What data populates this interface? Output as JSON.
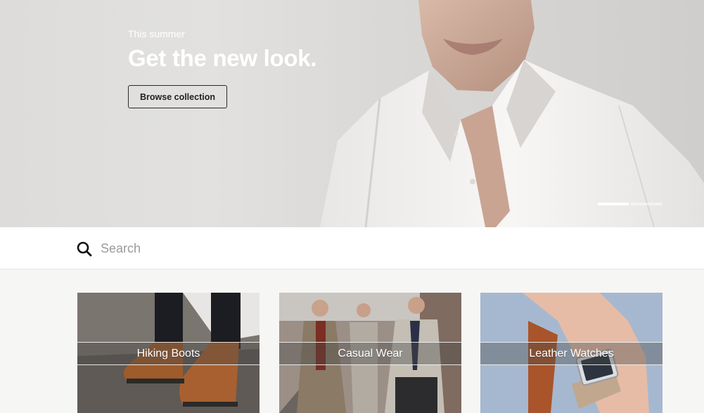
{
  "hero": {
    "kicker": "This summer",
    "title": "Get the new look.",
    "button_label": "Browse collection",
    "slides": [
      {
        "active": true
      },
      {
        "active": false
      }
    ]
  },
  "search": {
    "placeholder": "Search",
    "value": ""
  },
  "categories": [
    {
      "label": "Hiking Boots"
    },
    {
      "label": "Casual Wear"
    },
    {
      "label": "Leather Watches"
    }
  ],
  "colors": {
    "background": "#f6f6f5",
    "hero_text": "#ffffff",
    "button_border": "#2a2a2a",
    "search_placeholder": "#9a9a9a"
  }
}
